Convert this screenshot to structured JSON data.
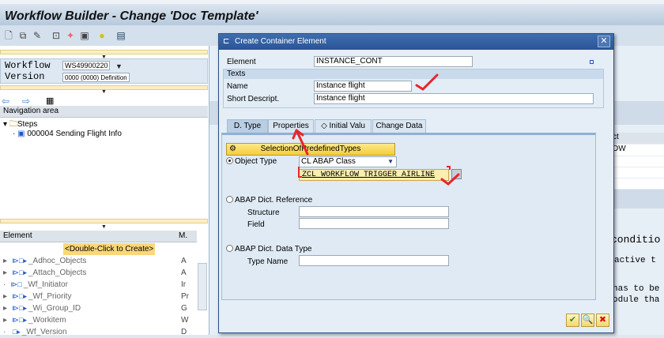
{
  "window": {
    "title": "Workflow Builder - Change 'Doc Template'"
  },
  "toolbar": {
    "icons": [
      "new-icon",
      "copy-icon",
      "edit-icon",
      "hierarchy-icon",
      "wand-icon",
      "monitor-icon",
      "bell-icon",
      "layout-icon"
    ]
  },
  "workflow_panel": {
    "workflow_label": "Workflow",
    "workflow_value": "WS49900220",
    "version_label": "Version",
    "version_value": "0000 (0000) Definition"
  },
  "navigation": {
    "header": "Navigation area",
    "steps_label": "Steps",
    "step_item": "000004 Sending Flight Info"
  },
  "container": {
    "col_element": "Element",
    "col_m": "M.",
    "create_label": "<Double-Click to Create>",
    "rows": [
      {
        "name": "_Adhoc_Objects",
        "m": "A"
      },
      {
        "name": "_Attach_Objects",
        "m": "A"
      },
      {
        "name": "_Wf_Initiator",
        "m": "Ir"
      },
      {
        "name": "_Wf_Priority",
        "m": "Pr"
      },
      {
        "name": "_Wi_Group_ID",
        "m": "G"
      },
      {
        "name": "_Workitem",
        "m": "W"
      },
      {
        "name": "_Wf_Version",
        "m": "D"
      }
    ]
  },
  "background_right": {
    "col_header": "ct",
    "cell": "DW",
    "text_lines": [
      "conditio",
      "active t",
      "has to be",
      "odule tha"
    ]
  },
  "dialog": {
    "title": "Create Container Element",
    "element_label": "Element",
    "element_value": "INSTANCE_CONT",
    "texts_header": "Texts",
    "name_label": "Name",
    "name_value": "Instance flight",
    "short_label": "Short Descript.",
    "short_value": "Instance flight",
    "tabs": [
      "D. Type",
      "Properties",
      "Initial Valu",
      "Change Data"
    ],
    "selection_button": "SelectionOfPredefinedTypes",
    "object_type_label": "Object Type",
    "object_type_value": "CL ABAP Class",
    "object_type_name": "ZCL WORKFLOW TRIGGER AIRLINE",
    "dict_ref_label": "ABAP Dict. Reference",
    "structure_label": "Structure",
    "field_label": "Field",
    "dict_type_label": "ABAP Dict. Data Type",
    "type_name_label": "Type Name",
    "annotation_color": "#e8262a"
  }
}
